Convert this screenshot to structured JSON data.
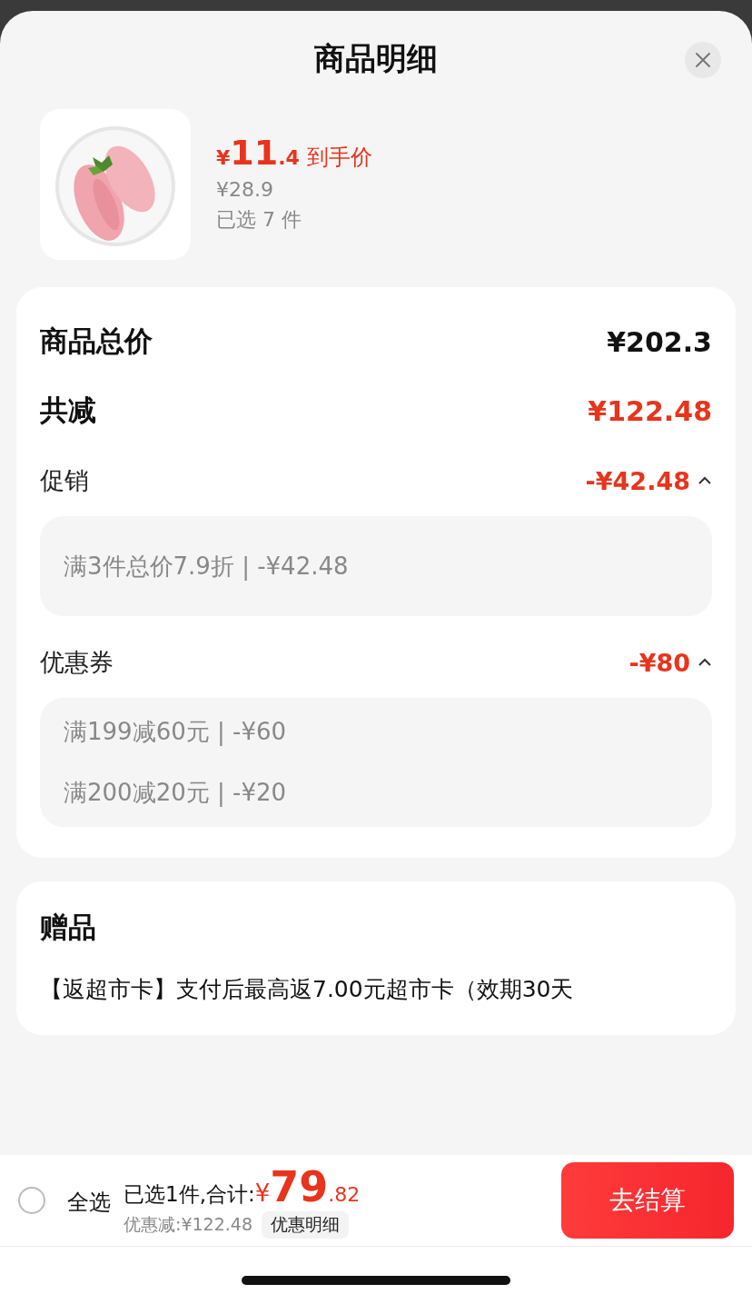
{
  "sheet": {
    "title": "商品明细"
  },
  "product": {
    "currency": "¥",
    "price_int": "11",
    "price_dec": ".4",
    "price_label": "到手价",
    "original_price": "¥28.9",
    "selected_count": "已选 7 件"
  },
  "summary": {
    "total": {
      "label": "商品总价",
      "value": "¥202.3"
    },
    "reduction": {
      "label": "共减",
      "value": "¥122.48"
    },
    "sections": [
      {
        "label": "促销",
        "value": "-¥42.48",
        "expanded": true,
        "details": [
          "满3件总价7.9折 | -¥42.48"
        ]
      },
      {
        "label": "优惠券",
        "value": "-¥80",
        "expanded": true,
        "details": [
          "满199减60元 | -¥60",
          "满200减20元 | -¥20"
        ]
      }
    ]
  },
  "gifts": {
    "title": "赠品",
    "text": "【返超市卡】支付后最高返7.00元超市卡（效期30天"
  },
  "footer": {
    "select_all": {
      "label": "全选",
      "checked": false
    },
    "summary_prefix": "已选1件,合计:",
    "currency": "¥",
    "total_int": "79",
    "total_dec": ".82",
    "discount": "优惠减:¥122.48",
    "details_button": "优惠明细",
    "checkout": "去结算"
  }
}
